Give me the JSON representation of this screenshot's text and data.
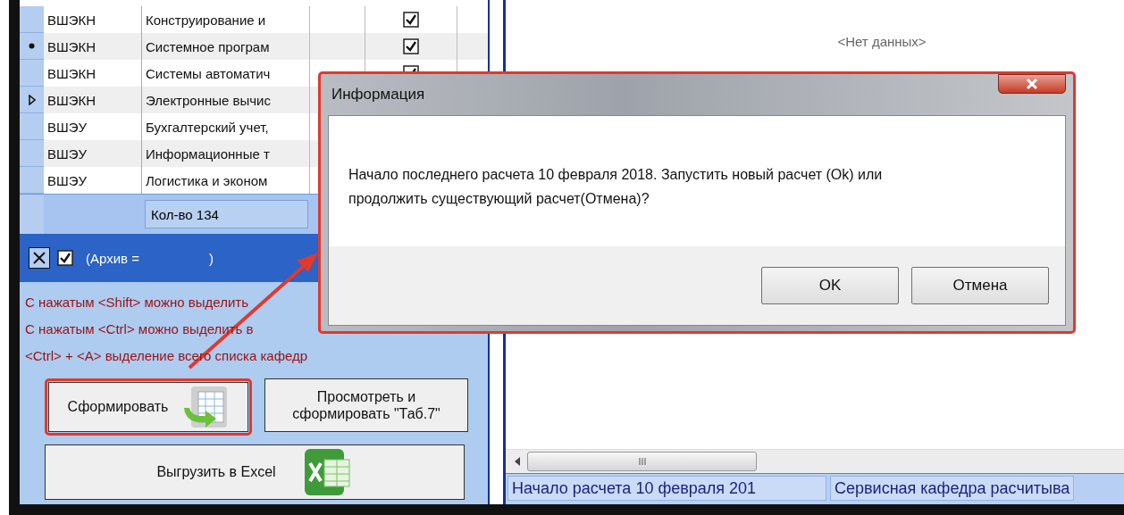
{
  "table": {
    "rows": [
      {
        "code": "ВШЭКН",
        "name": "Конструирование и",
        "checked": true,
        "marked": false,
        "selected": false
      },
      {
        "code": "ВШЭКН",
        "name": "Системное програм",
        "checked": true,
        "marked": true,
        "selected": false
      },
      {
        "code": "ВШЭКН",
        "name": "Системы автоматич",
        "checked": true,
        "marked": false,
        "selected": false
      },
      {
        "code": "ВШЭКН",
        "name": "Электронные вычис",
        "marked": false,
        "selected": true
      },
      {
        "code": "ВШЭУ",
        "name": "Бухгалтерский учет,",
        "marked": false,
        "selected": false
      },
      {
        "code": "ВШЭУ",
        "name": "Информационные т",
        "marked": false,
        "selected": false
      },
      {
        "code": "ВШЭУ",
        "name": "Логистика и эконом",
        "marked": false,
        "selected": false
      }
    ],
    "footer": "Кол-во  134"
  },
  "filter_bar": {
    "enabled": true,
    "label": "(Архив =",
    "closing": ")"
  },
  "hints": [
    "С нажатым <Shift> можно выделить",
    "С нажатым <Ctrl> можно выделить в",
    "<Ctrl> + <A> выделение всего списка кафедр"
  ],
  "buttons": [
    {
      "label": "Сформировать",
      "kind": "report",
      "highlighted": true
    },
    {
      "label": "Просмотреть и сформировать \"Таб.7\"",
      "kind": "plain",
      "highlighted": false
    },
    {
      "label": "Выгрузить в Excel",
      "kind": "excel",
      "highlighted": false
    }
  ],
  "right_panel": {
    "empty_text": "<Нет данных>"
  },
  "status_bar": [
    "Начало расчета 10 февраля 201",
    "Сервисная кафедра расчитыва"
  ],
  "dialog": {
    "title": "Информация",
    "message": "Начало последнего расчета 10 февраля 2018. Запустить новый расчет (Ok) или продолжить существующий расчет(Отмена)?",
    "buttons": [
      "OK",
      "Отмена"
    ]
  }
}
